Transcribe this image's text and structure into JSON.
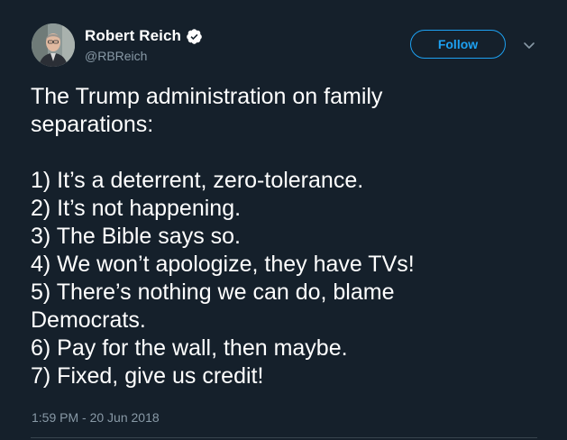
{
  "author": {
    "name": "Robert Reich",
    "handle": "@RBReich",
    "verified": true
  },
  "actions": {
    "follow_label": "Follow"
  },
  "tweet": {
    "intro_lines": [
      "The Trump administration on family",
      "separations:"
    ],
    "list_lines": [
      "1) It’s a deterrent, zero-tolerance.",
      "2) It’s not happening.",
      "3) The Bible says so.",
      "4) We won’t apologize, they have TVs!",
      "5) There’s nothing we can do, blame",
      "Democrats.",
      "6) Pay for the wall, then maybe.",
      "7) Fixed, give us credit!"
    ],
    "timestamp": "1:59 PM - 20 Jun 2018"
  },
  "colors": {
    "background": "#15202b",
    "text": "#ffffff",
    "secondary_text": "#8899a6",
    "accent": "#1da1f2"
  },
  "icons": {
    "verified": "verified-badge-icon",
    "menu": "chevron-down-icon"
  }
}
